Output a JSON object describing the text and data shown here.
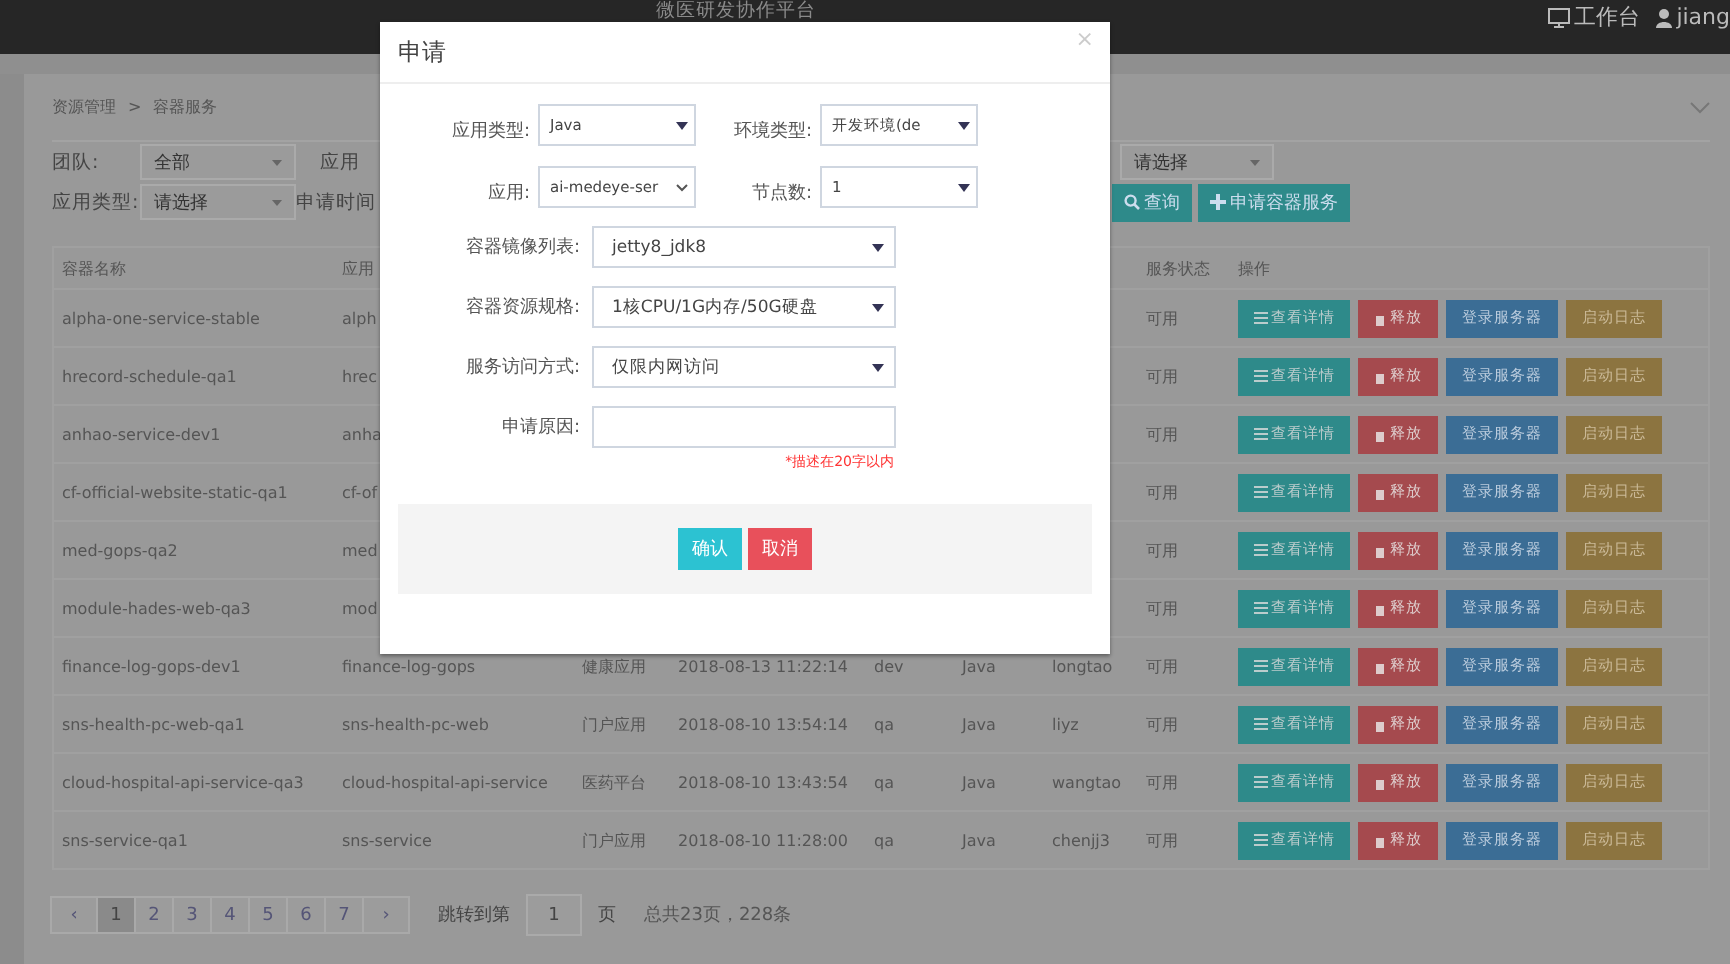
{
  "top_bar": {
    "title": "微医研发协作平台",
    "workbench": "工作台",
    "user": "jiang"
  },
  "breadcrumb": [
    "资源管理",
    "容器服务"
  ],
  "breadcrumb_separator": ">",
  "filters": {
    "row1": [
      {
        "label": "团队:",
        "value": "全部"
      },
      {
        "label": "应用"
      }
    ],
    "row1_right": {
      "value": "请选择"
    },
    "row2": [
      {
        "label": "应用类型:",
        "value": "请选择"
      },
      {
        "label": "申请时间"
      }
    ],
    "buttons": [
      {
        "kind": "search",
        "label": "查询"
      },
      {
        "kind": "add",
        "label": "申请容器服务"
      }
    ]
  },
  "table": {
    "columns": [
      "容器名称",
      "应用",
      "",
      "",
      "",
      "",
      "",
      "服务状态",
      "操作"
    ],
    "rows": [
      {
        "cells": [
          "alpha-one-service-stable",
          "alph",
          "",
          "",
          "",
          "",
          "",
          "可用"
        ],
        "actions": [
          {
            "kind": "detail",
            "label": "查看详情"
          },
          {
            "kind": "release",
            "label": "释放"
          },
          {
            "kind": "login",
            "label": "登录服务器"
          },
          {
            "kind": "log",
            "label": "启动日志"
          }
        ]
      },
      {
        "cells": [
          "hrecord-schedule-qa1",
          "hrec",
          "",
          "",
          "",
          "",
          "",
          "可用"
        ],
        "actions": [
          {
            "kind": "detail",
            "label": "查看详情"
          },
          {
            "kind": "release",
            "label": "释放"
          },
          {
            "kind": "login",
            "label": "登录服务器"
          },
          {
            "kind": "log",
            "label": "启动日志"
          }
        ]
      },
      {
        "cells": [
          "anhao-service-dev1",
          "anha",
          "",
          "",
          "",
          "",
          "",
          "可用"
        ],
        "actions": [
          {
            "kind": "detail",
            "label": "查看详情"
          },
          {
            "kind": "release",
            "label": "释放"
          },
          {
            "kind": "login",
            "label": "登录服务器"
          },
          {
            "kind": "log",
            "label": "启动日志"
          }
        ]
      },
      {
        "cells": [
          "cf-official-website-static-qa1",
          "cf-of",
          "",
          "",
          "",
          "",
          "",
          "可用"
        ],
        "actions": [
          {
            "kind": "detail",
            "label": "查看详情"
          },
          {
            "kind": "release",
            "label": "释放"
          },
          {
            "kind": "login",
            "label": "登录服务器"
          },
          {
            "kind": "log",
            "label": "启动日志"
          }
        ]
      },
      {
        "cells": [
          "med-gops-qa2",
          "med",
          "",
          "",
          "",
          "",
          "",
          "可用"
        ],
        "actions": [
          {
            "kind": "detail",
            "label": "查看详情"
          },
          {
            "kind": "release",
            "label": "释放"
          },
          {
            "kind": "login",
            "label": "登录服务器"
          },
          {
            "kind": "log",
            "label": "启动日志"
          }
        ]
      },
      {
        "cells": [
          "module-hades-web-qa3",
          "mod",
          "",
          "",
          "",
          "",
          "",
          "可用"
        ],
        "actions": [
          {
            "kind": "detail",
            "label": "查看详情"
          },
          {
            "kind": "release",
            "label": "释放"
          },
          {
            "kind": "login",
            "label": "登录服务器"
          },
          {
            "kind": "log",
            "label": "启动日志"
          }
        ]
      },
      {
        "cells": [
          "finance-log-gops-dev1",
          "finance-log-gops",
          "健康应用",
          "2018-08-13 11:22:14",
          "dev",
          "Java",
          "longtao",
          "可用"
        ],
        "actions": [
          {
            "kind": "detail",
            "label": "查看详情"
          },
          {
            "kind": "release",
            "label": "释放"
          },
          {
            "kind": "login",
            "label": "登录服务器"
          },
          {
            "kind": "log",
            "label": "启动日志"
          }
        ]
      },
      {
        "cells": [
          "sns-health-pc-web-qa1",
          "sns-health-pc-web",
          "门户应用",
          "2018-08-10 13:54:14",
          "qa",
          "Java",
          "liyz",
          "可用"
        ],
        "actions": [
          {
            "kind": "detail",
            "label": "查看详情"
          },
          {
            "kind": "release",
            "label": "释放"
          },
          {
            "kind": "login",
            "label": "登录服务器"
          },
          {
            "kind": "log",
            "label": "启动日志"
          }
        ]
      },
      {
        "cells": [
          "cloud-hospital-api-service-qa3",
          "cloud-hospital-api-service",
          "医药平台",
          "2018-08-10 13:43:54",
          "qa",
          "Java",
          "wangtao",
          "可用"
        ],
        "actions": [
          {
            "kind": "detail",
            "label": "查看详情"
          },
          {
            "kind": "release",
            "label": "释放"
          },
          {
            "kind": "login",
            "label": "登录服务器"
          },
          {
            "kind": "log",
            "label": "启动日志"
          }
        ]
      },
      {
        "cells": [
          "sns-service-qa1",
          "sns-service",
          "门户应用",
          "2018-08-10 11:28:00",
          "qa",
          "Java",
          "chenjj3",
          "可用"
        ],
        "actions": [
          {
            "kind": "detail",
            "label": "查看详情"
          },
          {
            "kind": "release",
            "label": "释放"
          },
          {
            "kind": "login",
            "label": "登录服务器"
          },
          {
            "kind": "log",
            "label": "启动日志"
          }
        ]
      }
    ]
  },
  "pagination": {
    "prev": "‹",
    "pages": [
      {
        "label": "1",
        "selected": true
      },
      {
        "label": "2",
        "selected": false
      },
      {
        "label": "3",
        "selected": false
      },
      {
        "label": "4",
        "selected": false
      },
      {
        "label": "5",
        "selected": false
      },
      {
        "label": "6",
        "selected": false
      },
      {
        "label": "7",
        "selected": false
      }
    ],
    "next": "›",
    "jump_label": "跳转到第",
    "jump_value": "1",
    "jump_suffix": "页",
    "total": "总共23页，228条"
  },
  "modal": {
    "title": "申请",
    "close": "×",
    "pairs": [
      [
        {
          "label": "应用类型:",
          "value": "Java",
          "kind": "select"
        },
        {
          "label": "环境类型:",
          "value": "开发环境(de",
          "kind": "select"
        }
      ],
      [
        {
          "label": "应用:",
          "value": "ai-medeye-ser",
          "kind": "combo"
        },
        {
          "label": "节点数:",
          "value": "1",
          "kind": "select"
        }
      ]
    ],
    "fields": [
      {
        "kind": "select",
        "label": "容器镜像列表:",
        "value": "jetty8_jdk8"
      },
      {
        "kind": "select",
        "label": "容器资源规格:",
        "value": "1核CPU/1G内存/50G硬盘"
      },
      {
        "kind": "select",
        "label": "服务访问方式:",
        "value": "仅限内网访问"
      },
      {
        "kind": "input",
        "label": "申请原因:"
      }
    ],
    "hint": "*描述在20字以内",
    "buttons": [
      {
        "kind": "confirm",
        "label": "确认"
      },
      {
        "kind": "cancel",
        "label": "取消"
      }
    ]
  }
}
